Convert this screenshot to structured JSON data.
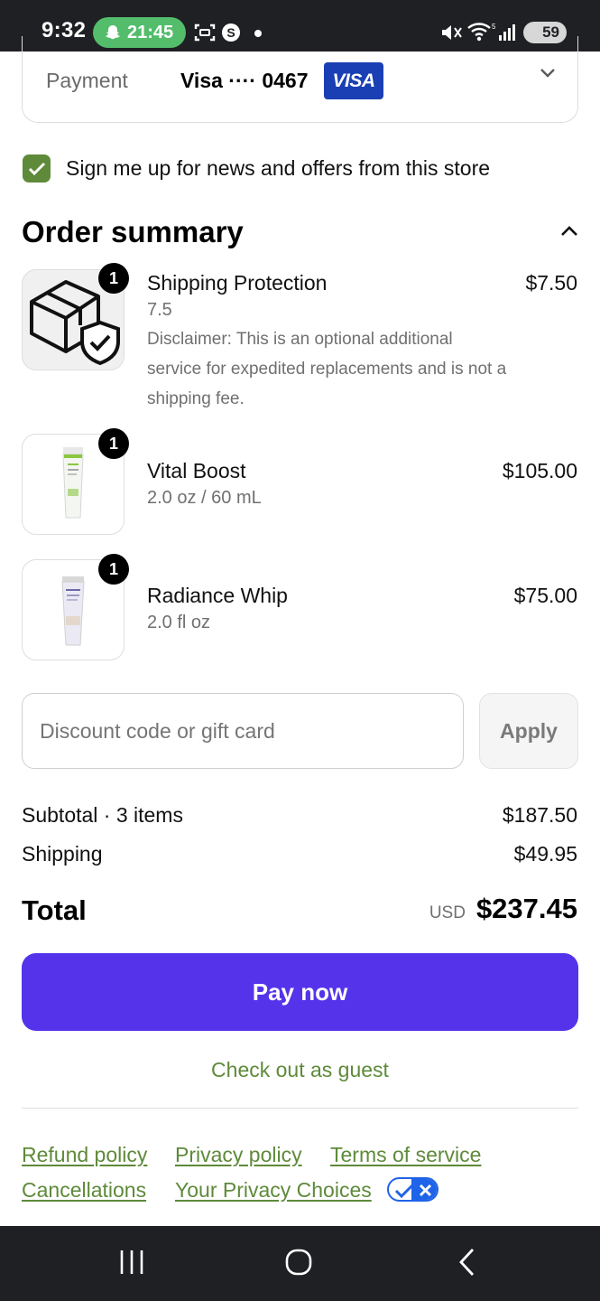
{
  "status_bar": {
    "time": "9:32",
    "pill_time": "21:45",
    "battery": "59"
  },
  "payment": {
    "label": "Payment",
    "card": "Visa ···· 0467",
    "brand": "VISA"
  },
  "newsletter": {
    "label": "Sign me up for news and offers from this store",
    "checked": true
  },
  "order_summary": {
    "heading": "Order summary",
    "items": [
      {
        "name": "Shipping Protection",
        "variant": "7.5",
        "description": "Disclaimer: This is an optional additional service for expedited replacements and is not a shipping fee.",
        "price": "$7.50",
        "quantity": "1"
      },
      {
        "name": "Vital Boost",
        "variant": "2.0 oz / 60 mL",
        "price": "$105.00",
        "quantity": "1"
      },
      {
        "name": "Radiance Whip",
        "variant": "2.0 fl oz",
        "price": "$75.00",
        "quantity": "1"
      }
    ]
  },
  "discount": {
    "placeholder": "Discount code or gift card",
    "apply_label": "Apply"
  },
  "totals": {
    "subtotal_label": "Subtotal · 3 items",
    "subtotal_value": "$187.50",
    "shipping_label": "Shipping",
    "shipping_value": "$49.95",
    "total_label": "Total",
    "currency": "USD",
    "total_value": "$237.45"
  },
  "actions": {
    "pay_now": "Pay now",
    "guest": "Check out as guest"
  },
  "footer": {
    "links": [
      "Refund policy",
      "Privacy policy",
      "Terms of service",
      "Cancellations",
      "Your Privacy Choices"
    ]
  },
  "colors": {
    "accent_green": "#5e8a3a",
    "pay_button": "#5433eb",
    "visa_blue": "#1a3fb4"
  }
}
